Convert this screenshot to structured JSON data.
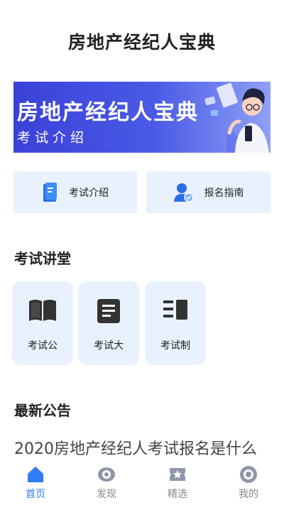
{
  "header": {
    "title": "房地产经纪人宝典"
  },
  "banner": {
    "title": "房地产经纪人宝典",
    "subtitle": "考试介绍"
  },
  "quick_links": [
    {
      "label": "考试介绍",
      "icon": "book-icon"
    },
    {
      "label": "报名指南",
      "icon": "user-badge-icon"
    }
  ],
  "lecture": {
    "title": "考试讲堂",
    "items": [
      {
        "label": "考试公",
        "icon": "open-book-icon"
      },
      {
        "label": "考试大",
        "icon": "document-icon"
      },
      {
        "label": "考试制",
        "icon": "list-icon"
      }
    ]
  },
  "notices": {
    "title": "最新公告",
    "items": [
      "2020房地产经纪人考试报名是什么"
    ]
  },
  "tabbar": {
    "active_color": "#2f7cf6",
    "tabs": [
      {
        "label": "首页",
        "icon": "home-icon",
        "active": true
      },
      {
        "label": "发现",
        "icon": "eye-icon",
        "active": false
      },
      {
        "label": "精选",
        "icon": "ticket-star-icon",
        "active": false
      },
      {
        "label": "我的",
        "icon": "profile-circle-icon",
        "active": false
      }
    ]
  }
}
